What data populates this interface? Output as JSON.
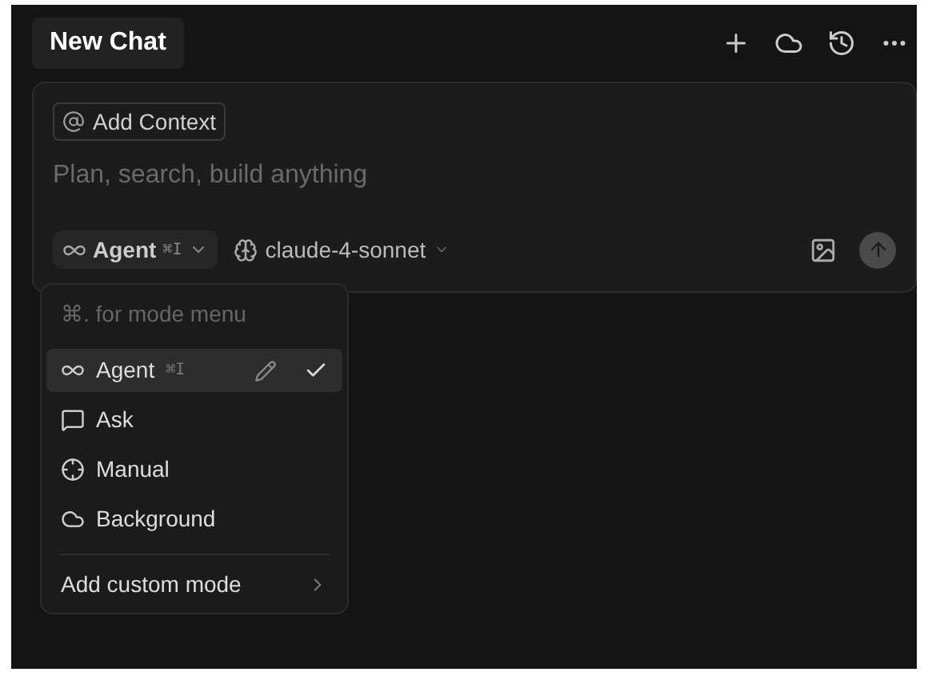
{
  "tab": {
    "title": "New Chat"
  },
  "composer": {
    "context_button": "Add Context",
    "placeholder": "Plan, search, build anything",
    "mode": {
      "label": "Agent",
      "shortcut": "⌘I"
    },
    "model": "claude-4-sonnet"
  },
  "mode_menu": {
    "hint": "⌘. for mode menu",
    "items": [
      {
        "kind": "agent",
        "label": "Agent",
        "shortcut": "⌘I",
        "selected": true
      },
      {
        "kind": "ask",
        "label": "Ask",
        "selected": false
      },
      {
        "kind": "manual",
        "label": "Manual",
        "selected": false
      },
      {
        "kind": "background",
        "label": "Background",
        "selected": false
      }
    ],
    "footer": "Add custom mode"
  }
}
